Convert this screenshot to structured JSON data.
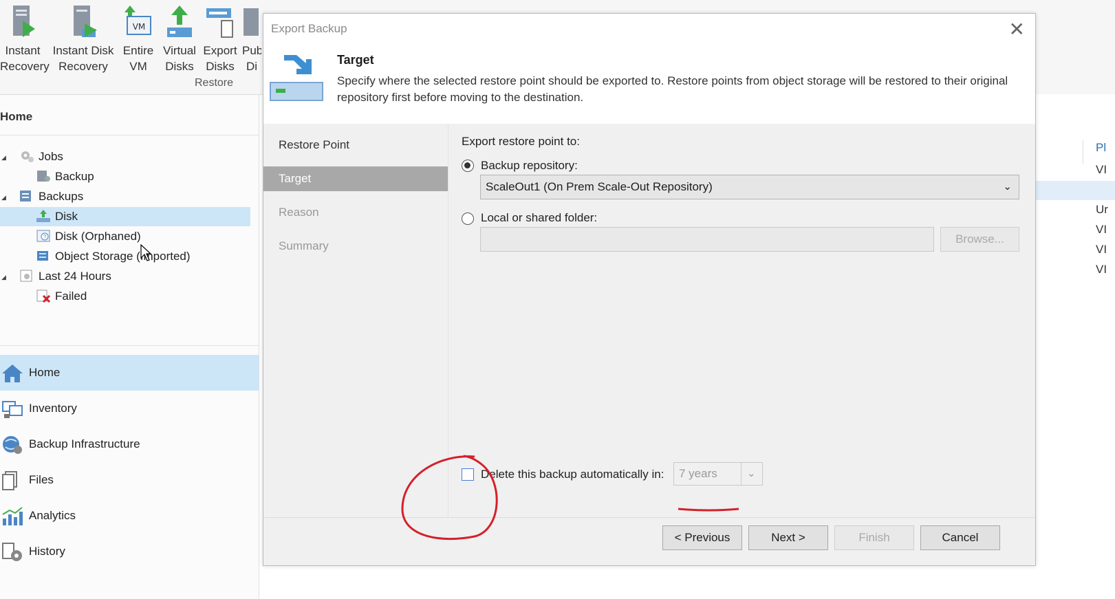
{
  "ribbon": {
    "buttons": [
      {
        "l1": "Instant",
        "l2": "Recovery"
      },
      {
        "l1": "Instant Disk",
        "l2": "Recovery"
      },
      {
        "l1": "Entire",
        "l2": "VM"
      },
      {
        "l1": "Virtual",
        "l2": "Disks"
      },
      {
        "l1": "Export",
        "l2": "Disks"
      },
      {
        "l1": "Pub",
        "l2": "Di"
      }
    ],
    "group_label": "Restore",
    "vm_badge": "VM"
  },
  "nav": {
    "home_title": "Home",
    "tree": [
      {
        "label": "Jobs"
      },
      {
        "label": "Backup"
      },
      {
        "label": "Backups"
      },
      {
        "label": "Disk"
      },
      {
        "label": "Disk (Orphaned)"
      },
      {
        "label": "Object Storage (Imported)"
      },
      {
        "label": "Last 24 Hours"
      },
      {
        "label": "Failed"
      }
    ],
    "items": [
      {
        "label": "Home"
      },
      {
        "label": "Inventory"
      },
      {
        "label": "Backup Infrastructure"
      },
      {
        "label": "Files"
      },
      {
        "label": "Analytics"
      },
      {
        "label": "History"
      }
    ]
  },
  "right_panel": {
    "texts": [
      "Pl",
      "VI",
      "Ur",
      "VI",
      "VI",
      "VI"
    ]
  },
  "dialog": {
    "title": "Export Backup",
    "close_glyph": "✕",
    "header_title": "Target",
    "header_desc": "Specify where the selected restore point should be exported to. Restore points from object storage will be restored to their original repository first before moving to the destination.",
    "steps": [
      {
        "label": "Restore Point"
      },
      {
        "label": "Target"
      },
      {
        "label": "Reason"
      },
      {
        "label": "Summary"
      }
    ],
    "export_label": "Export restore point to:",
    "repo_radio_label": "Backup repository:",
    "repo_value": "ScaleOut1 (On Prem Scale-Out Repository)",
    "folder_radio_label": "Local or shared folder:",
    "folder_value": "",
    "browse_label": "Browse...",
    "delete_label": "Delete this backup automatically in:",
    "retention_value": "7 years",
    "buttons": {
      "previous": "< Previous",
      "next": "Next >",
      "finish": "Finish",
      "cancel": "Cancel"
    }
  },
  "colors": {
    "accent": "#2a6fb5",
    "selection": "#cde6f7",
    "annotation": "#d4202a"
  }
}
